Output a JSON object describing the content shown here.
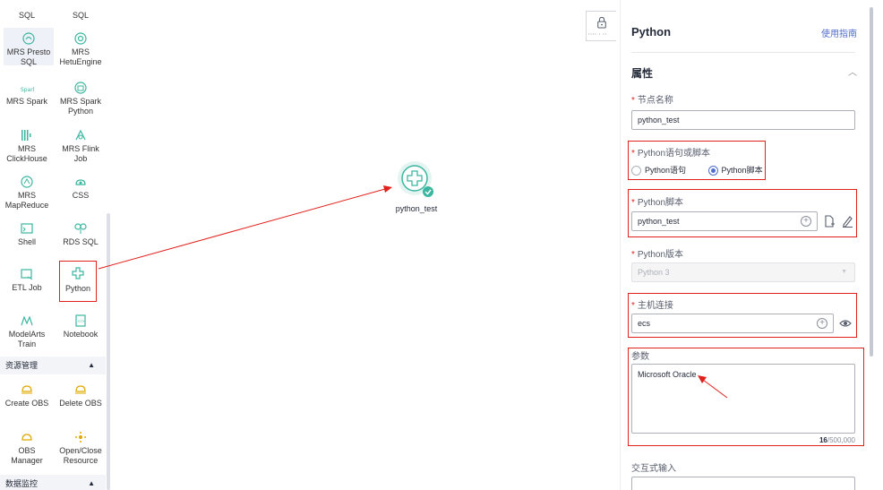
{
  "palette": {
    "items": [
      {
        "label": "SQL",
        "icon": "mrs-spark-sql-icon"
      },
      {
        "label": "SQL",
        "icon": "mrs-hive-sql-icon"
      },
      {
        "label": "MRS Presto\nSQL",
        "icon": "mrs-presto-icon"
      },
      {
        "label": "MRS\nHetuEngine",
        "icon": "mrs-hetuengine-icon"
      },
      {
        "label": "MRS Spark",
        "icon": "mrs-spark-icon"
      },
      {
        "label": "MRS Spark\nPython",
        "icon": "mrs-spark-python-icon"
      },
      {
        "label": "MRS\nClickHouse",
        "icon": "mrs-clickhouse-icon"
      },
      {
        "label": "MRS Flink\nJob",
        "icon": "mrs-flink-icon"
      },
      {
        "label": "MRS\nMapReduce",
        "icon": "mrs-mapreduce-icon"
      },
      {
        "label": "CSS",
        "icon": "css-icon"
      },
      {
        "label": "Shell",
        "icon": "shell-icon"
      },
      {
        "label": "RDS SQL",
        "icon": "rds-sql-icon"
      },
      {
        "label": "ETL Job",
        "icon": "etl-job-icon"
      },
      {
        "label": "Python",
        "icon": "python-icon"
      },
      {
        "label": "ModelArts\nTrain",
        "icon": "modelarts-train-icon"
      },
      {
        "label": "Notebook",
        "icon": "notebook-icon"
      },
      {
        "label": "Create OBS",
        "icon": "create-obs-icon"
      },
      {
        "label": "Delete OBS",
        "icon": "delete-obs-icon"
      },
      {
        "label": "OBS\nManager",
        "icon": "obs-manager-icon"
      },
      {
        "label": "Open/Close\nResource",
        "icon": "open-close-resource-icon"
      }
    ],
    "sections": {
      "resource": "资源管理",
      "monitor": "数据监控"
    }
  },
  "canvas": {
    "node_label": "python_test"
  },
  "panel": {
    "title": "Python",
    "guide_link": "使用指南",
    "section_title": "属性",
    "node_name_label": "节点名称",
    "node_name_value": "python_test",
    "stmt_or_script_label": "Python语句或脚本",
    "radio_statement": "Python语句",
    "radio_script": "Python脚本",
    "script_label": "Python脚本",
    "script_value": "python_test",
    "version_label": "Python版本",
    "version_value": "Python 3",
    "host_label": "主机连接",
    "host_value": "ecs",
    "params_label": "参数",
    "params_value": "Microsoft Oracle",
    "char_count": "16",
    "char_limit": "/500,000",
    "interactive_label": "交互式输入"
  },
  "colors": {
    "accent": "#526ecc",
    "annotation_red": "#e0201b",
    "node_teal": "#3bb6a0"
  }
}
